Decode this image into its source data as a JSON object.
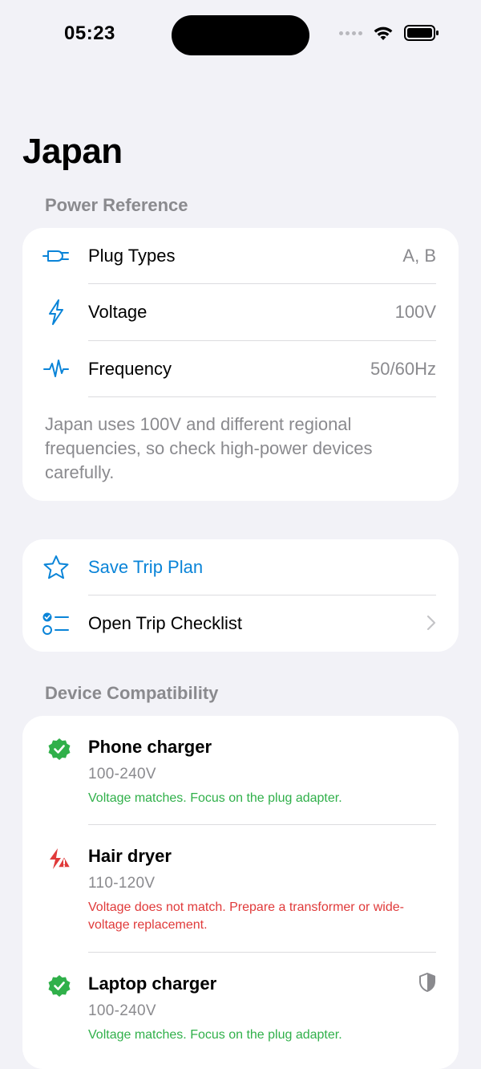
{
  "status_bar": {
    "time": "05:23"
  },
  "page": {
    "title": "Japan"
  },
  "power_reference": {
    "header": "Power Reference",
    "rows": [
      {
        "label": "Plug Types",
        "value": "A, B",
        "icon": "plug-icon"
      },
      {
        "label": "Voltage",
        "value": "100V",
        "icon": "bolt-icon"
      },
      {
        "label": "Frequency",
        "value": "50/60Hz",
        "icon": "waveform-icon"
      }
    ],
    "note": "Japan uses 100V and different regional frequencies, so check high-power devices carefully."
  },
  "actions": {
    "save_label": "Save Trip Plan",
    "checklist_label": "Open Trip Checklist"
  },
  "devices": {
    "header": "Device Compatibility",
    "items": [
      {
        "name": "Phone charger",
        "voltage": "100-240V",
        "status": "Voltage matches. Focus on the plug adapter.",
        "ok": true
      },
      {
        "name": "Hair dryer",
        "voltage": "110-120V",
        "status": "Voltage does not match. Prepare a transformer or wide-voltage replacement.",
        "ok": false
      },
      {
        "name": "Laptop charger",
        "voltage": "100-240V",
        "status": "Voltage matches. Focus on the plug adapter.",
        "ok": true
      }
    ]
  },
  "colors": {
    "accent": "#0a84d8",
    "ok": "#30b04a",
    "bad": "#e03a3a",
    "background": "#f2f2f7"
  }
}
